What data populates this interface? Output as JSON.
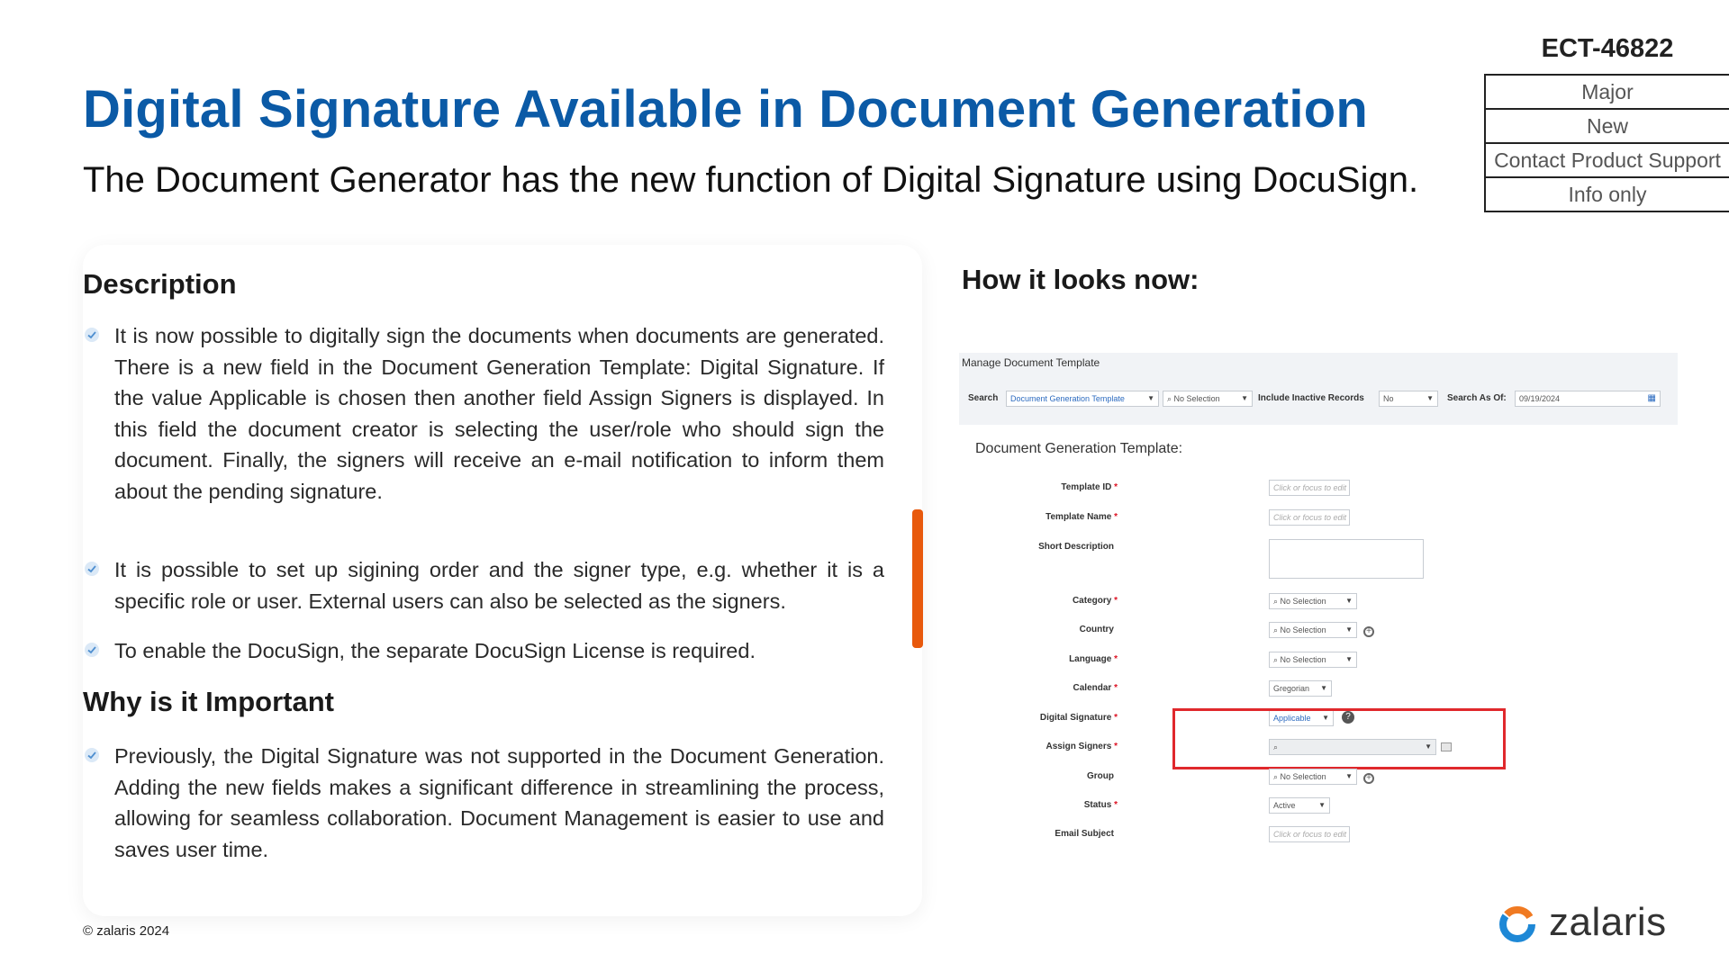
{
  "header": {
    "title": "Digital Signature Available in Document Generation",
    "subtitle": "The Document Generator has the new function of Digital Signature using DocuSign."
  },
  "ticket": {
    "id": "ECT-46822",
    "tags": [
      "Major",
      "New",
      "Contact Product Support",
      "Info only"
    ]
  },
  "description": {
    "heading": "Description",
    "bullets": [
      "It is now possible to digitally sign the documents when documents are generated. There is a new field in the Document Generation Template: Digital Signature. If the value Applicable is chosen then another field Assign Signers is displayed. In this field the document creator is selecting the user/role who should sign the document. Finally, the signers will receive an e-mail notification to inform them about the pending signature.",
      "It is possible to set up sigining order and the signer type, e.g. whether it is a specific role or user. External users can also be selected as the signers.",
      "To enable the DocuSign, the separate DocuSign License is required."
    ]
  },
  "importance": {
    "heading": "Why is it Important",
    "bullets": [
      "Previously, the Digital Signature was not supported in the Document Generation. Adding the new fields makes a significant difference in streamlining the process, allowing for seamless collaboration. Document Management is easier to use and saves user time."
    ]
  },
  "preview": {
    "heading": "How it looks now:",
    "window_title": "Manage Document Template",
    "filters": {
      "search_label": "Search",
      "search_value": "Document Generation Template",
      "selection_value": "No Selection",
      "inactive_label": "Include Inactive Records",
      "inactive_value": "No",
      "asof_label": "Search As Of:",
      "asof_value": "09/19/2024"
    },
    "form_title": "Document Generation Template:",
    "fields": {
      "template_id": {
        "label": "Template ID",
        "value": "Click or focus to edit"
      },
      "template_name": {
        "label": "Template Name",
        "value": "Click or focus to edit"
      },
      "short_description": {
        "label": "Short Description"
      },
      "category": {
        "label": "Category",
        "value": "No Selection"
      },
      "country": {
        "label": "Country",
        "value": "No Selection"
      },
      "language": {
        "label": "Language",
        "value": "No Selection"
      },
      "calendar": {
        "label": "Calendar",
        "value": "Gregorian"
      },
      "digital_signature": {
        "label": "Digital Signature",
        "value": "Applicable"
      },
      "assign_signers": {
        "label": "Assign Signers"
      },
      "group": {
        "label": "Group",
        "value": "No Selection"
      },
      "status": {
        "label": "Status",
        "value": "Active"
      },
      "email_subject": {
        "label": "Email Subject",
        "value": "Click or focus to edit"
      }
    },
    "required_mark": "*"
  },
  "footer": {
    "copyright": "© zalaris 2024",
    "brand": "zalaris"
  },
  "colors": {
    "title_blue": "#0b5aa6",
    "accent_orange": "#e8590c",
    "highlight_red": "#e0282c",
    "logo_blue": "#1e88d6",
    "logo_orange": "#f07a22"
  }
}
